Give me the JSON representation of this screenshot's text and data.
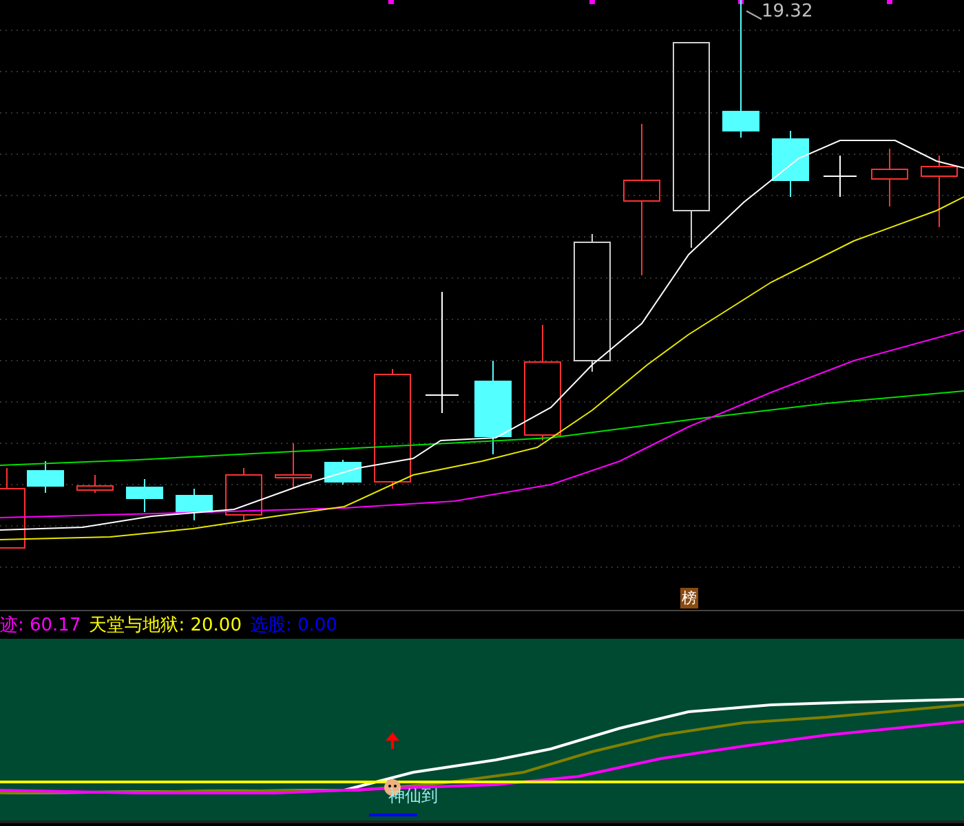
{
  "main_chart": {
    "high_label": "19.32",
    "badge": "榜"
  },
  "indicator_legend": [
    {
      "label": "迹: 60.17",
      "color": "#ff00ff"
    },
    {
      "label": "天堂与地狱: 20.00",
      "color": "#ffff00"
    },
    {
      "label": "选股: 0.00",
      "color": "#0000ff"
    }
  ],
  "sub_chart": {
    "signal_label": "神仙到"
  }
}
